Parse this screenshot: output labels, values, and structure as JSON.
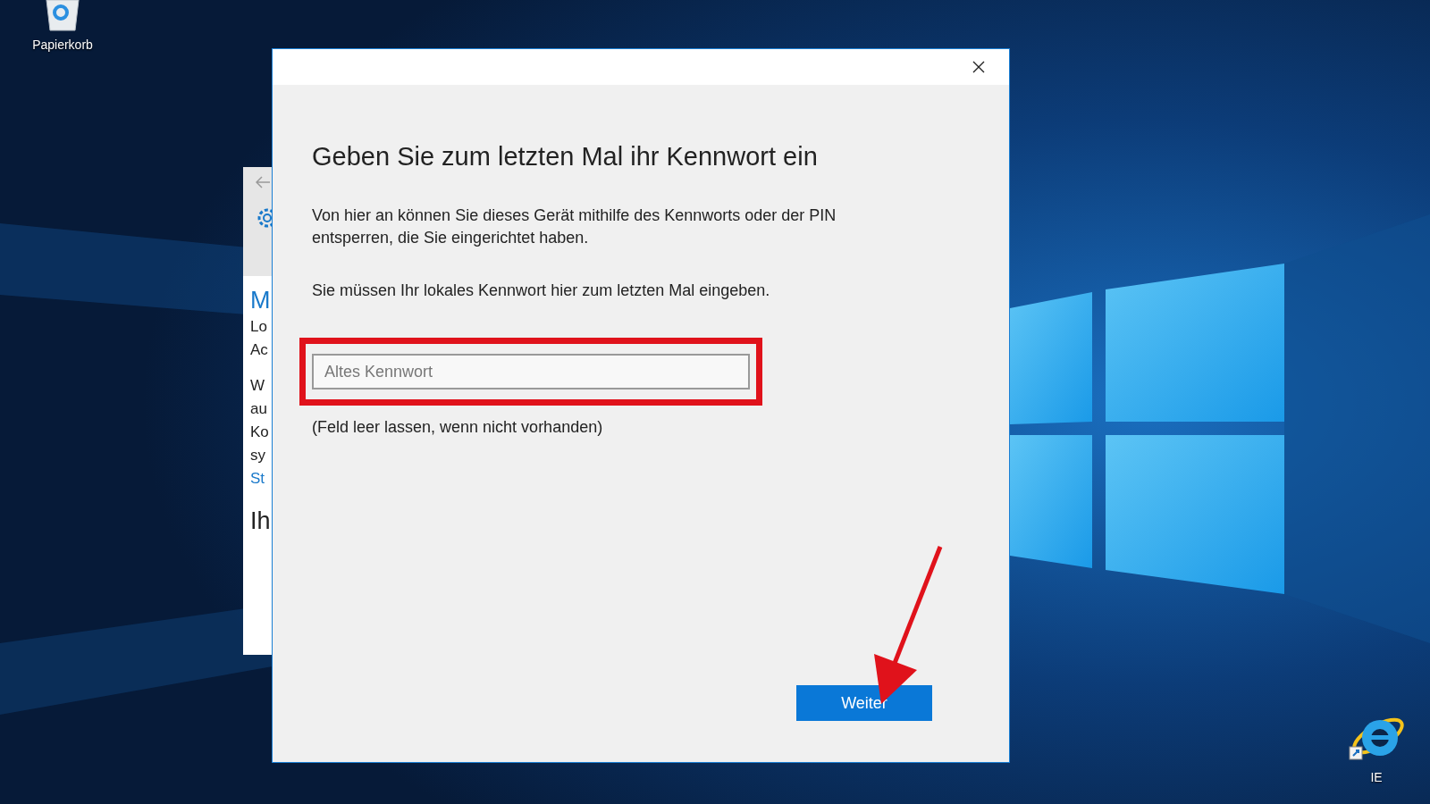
{
  "desktop": {
    "icons": [
      {
        "kind": "recycle-bin",
        "label": "Papierkorb"
      },
      {
        "kind": "browser",
        "label": "IE"
      }
    ]
  },
  "background_window": {
    "lines": [
      {
        "kind": "heading",
        "text": "M"
      },
      {
        "kind": "text",
        "text": "Lo"
      },
      {
        "kind": "text",
        "text": "Ac"
      },
      {
        "kind": "gap"
      },
      {
        "kind": "text",
        "text": "W"
      },
      {
        "kind": "text",
        "text": "au"
      },
      {
        "kind": "text",
        "text": "Ko"
      },
      {
        "kind": "text",
        "text": "sy"
      },
      {
        "kind": "link",
        "text": "St"
      },
      {
        "kind": "gap"
      },
      {
        "kind": "subheading",
        "text": "Ih"
      }
    ]
  },
  "dialog": {
    "heading": "Geben Sie zum letzten Mal ihr Kennwort ein",
    "paragraphs": [
      "Von hier an können Sie dieses Gerät mithilfe des Kennworts oder der PIN entsperren, die Sie eingerichtet haben.",
      "Sie müssen Ihr lokales Kennwort hier zum letzten Mal eingeben."
    ],
    "password_field": {
      "placeholder": "Altes Kennwort",
      "highlighted": true
    },
    "hint": "(Feld leer lassen, wenn nicht vorhanden)",
    "button": "Weiter"
  }
}
